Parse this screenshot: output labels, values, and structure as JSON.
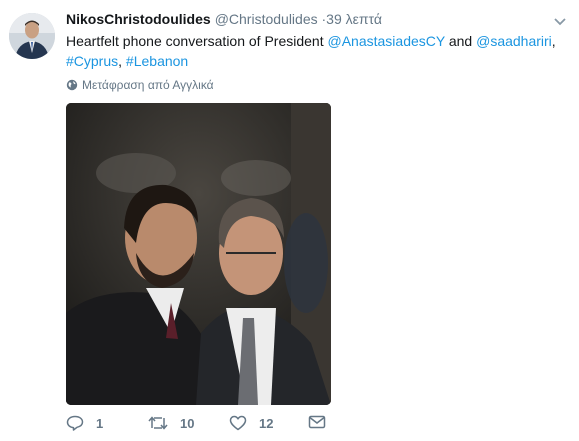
{
  "tweet": {
    "author_name": "NikosChristodoulides",
    "author_handle": "@Christodulides",
    "separator": "·",
    "time": "39 λεπτά",
    "text_before": "Heartfelt phone conversation of President ",
    "mention1": "@AnastasiadesCY",
    "text_and": " and ",
    "mention2": "@saadhariri",
    "text_comma": ",",
    "hashtag1": "#Cyprus",
    "text_comma2": ", ",
    "hashtag2": "#Lebanon",
    "translate_label": "Μετάφραση από Αγγλικά",
    "replies": "1",
    "retweets": "10",
    "likes": "12"
  },
  "icons": {
    "reply": "reply-icon",
    "retweet": "retweet-icon",
    "like": "heart-icon",
    "dm": "envelope-icon",
    "globe": "globe-icon",
    "more": "chevron-down-icon"
  },
  "colors": {
    "link": "#1b95e0",
    "secondary_text": "#657786",
    "primary_text": "#14171a"
  }
}
